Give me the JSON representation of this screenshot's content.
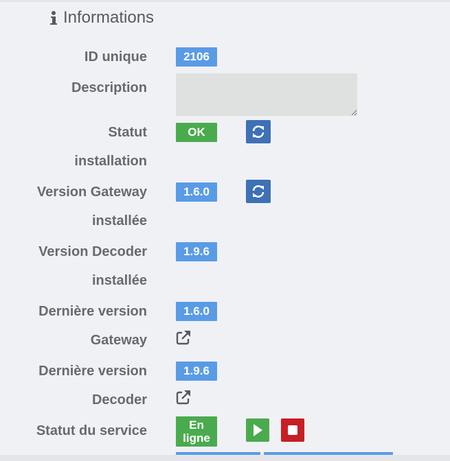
{
  "section": {
    "title": "Informations",
    "icon": "info-icon"
  },
  "fields": {
    "id_unique": {
      "label": "ID unique",
      "value": "2106"
    },
    "description": {
      "label": "Description",
      "value": ""
    },
    "statut_installation": {
      "label_line1": "Statut",
      "label_line2": "installation",
      "value": "OK"
    },
    "version_gateway": {
      "label_line1": "Version Gateway",
      "label_line2": "installée",
      "value": "1.6.0"
    },
    "version_decoder": {
      "label_line1": "Version Decoder",
      "label_line2": "installée",
      "value": "1.9.6"
    },
    "derniere_gateway": {
      "label_line1": "Dernière version",
      "label_line2": "Gateway",
      "value": "1.6.0"
    },
    "derniere_decoder": {
      "label_line1": "Dernière version",
      "label_line2": "Decoder",
      "value": "1.9.6"
    },
    "statut_service": {
      "label": "Statut du service",
      "value_line1": "En",
      "value_line2": "ligne"
    }
  },
  "colors": {
    "badge_blue": "#5a9be6",
    "badge_green": "#4aab4e",
    "refresh_button": "#3e71b5",
    "play_button": "#4aab4e",
    "stop_button": "#c61f26",
    "label_text": "#666a70"
  },
  "icons": {
    "refresh": "refresh-icon",
    "external_link": "external-link-icon",
    "play": "play-icon",
    "stop": "stop-icon"
  }
}
